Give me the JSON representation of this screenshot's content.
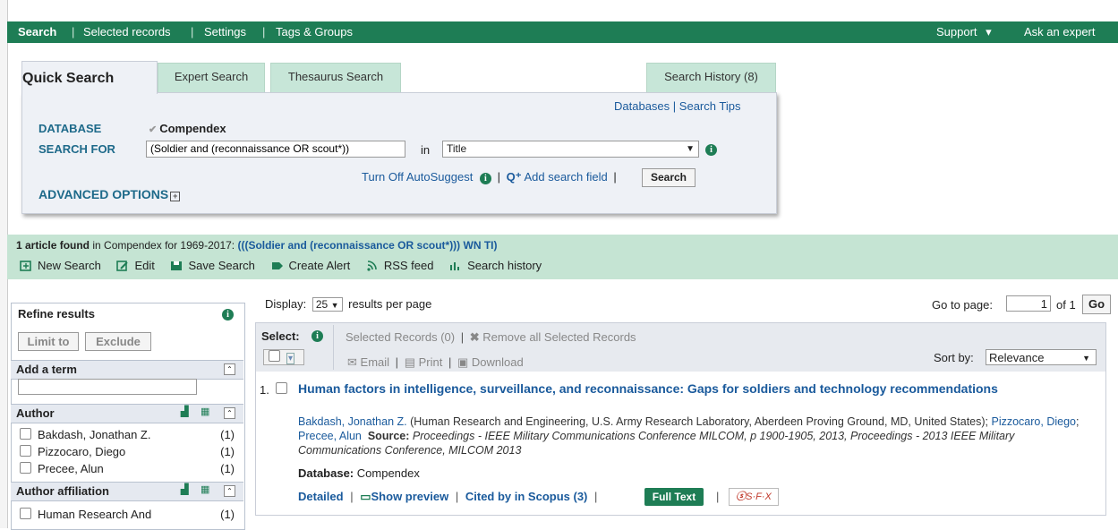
{
  "nav": {
    "items": [
      "Search",
      "Selected records",
      "Settings",
      "Tags & Groups"
    ],
    "support": "Support",
    "support_caret": "▾",
    "ask": "Ask an expert"
  },
  "tabs": {
    "quick": "Quick Search",
    "expert": "Expert Search",
    "thesaurus": "Thesaurus Search",
    "history": "Search History (8)"
  },
  "panel": {
    "databases_link": "Databases",
    "sep": "|",
    "tips_link": "Search Tips",
    "database_label": "DATABASE",
    "database_value": "Compendex",
    "searchfor_label": "SEARCH FOR",
    "search_value": "(Soldier and (reconnaissance OR scout*))",
    "in_label": "in",
    "field_value": "Title",
    "autosuggest": "Turn Off AutoSuggest",
    "add_field": "Add search field",
    "search_button": "Search",
    "advanced": "ADVANCED OPTIONS"
  },
  "results_header": {
    "count_bold": "1 article found",
    "rest": " in Compendex for 1969-2017: ",
    "query": "(((Soldier and (reconnaissance OR scout*))) WN TI)",
    "tools": [
      "New Search",
      "Edit",
      "Save Search",
      "Create Alert",
      "RSS feed",
      "Search history"
    ]
  },
  "refine": {
    "title": "Refine results",
    "limit": "Limit to",
    "exclude": "Exclude",
    "add_term": "Add a term",
    "author_label": "Author",
    "authors": [
      {
        "name": "Bakdash, Jonathan Z.",
        "count": "(1)"
      },
      {
        "name": "Pizzocaro, Diego",
        "count": "(1)"
      },
      {
        "name": "Precee, Alun",
        "count": "(1)"
      }
    ],
    "affil_label": "Author affiliation",
    "affils": [
      {
        "name": "Human Research And",
        "count": "(1)"
      }
    ]
  },
  "display": {
    "label": "Display:",
    "value": "25",
    "suffix": "results per page",
    "goto": "Go to page:",
    "page": "1",
    "of": "of 1",
    "go": "Go"
  },
  "selbar": {
    "select": "Select:",
    "selected": "Selected Records (0)",
    "remove": "Remove all Selected Records",
    "email": "Email",
    "print": "Print",
    "download": "Download",
    "sortby": "Sort by:",
    "sort_value": "Relevance"
  },
  "result": {
    "num": "1.",
    "title": "Human factors in intelligence, surveillance, and reconnaissance: Gaps for soldiers and technology recommendations",
    "author1": "Bakdash, Jonathan Z.",
    "affil": " (Human Research and Engineering, U.S. Army Research Laboratory, Aberdeen Proving Ground, MD, United States); ",
    "author2": "Pizzocaro, Diego",
    "author3": "Precee, Alun",
    "source_label": "Source:",
    "source": "Proceedings - IEEE Military Communications Conference MILCOM, p 1900-1905, 2013, Proceedings - 2013 IEEE Military Communications Conference, MILCOM 2013",
    "database_label": "Database:",
    "database": "Compendex",
    "detailed": "Detailed",
    "preview": "Show preview",
    "cited": "Cited by in Scopus (3)",
    "fulltext": "Full Text",
    "sfx": "S·F·X"
  },
  "colors": {
    "nav_green": "#1e7d55",
    "tab_mint": "#c7e6d8",
    "band_mint": "#c5e4d3",
    "link": "#1a5a9c"
  }
}
